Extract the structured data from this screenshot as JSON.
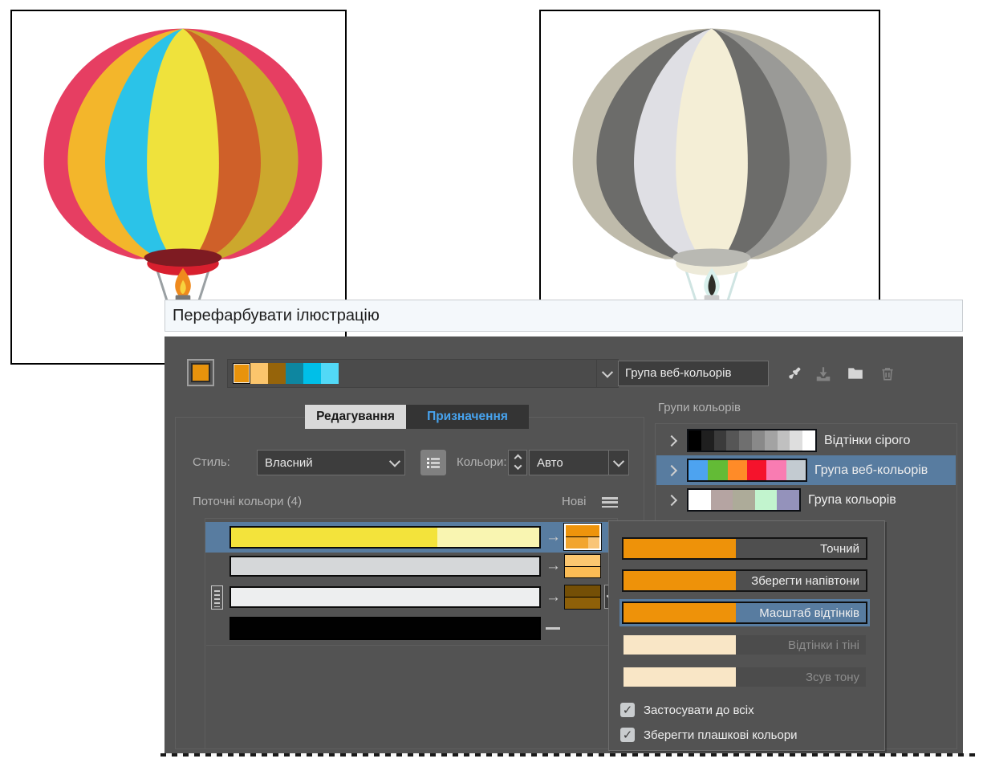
{
  "dialog": {
    "title": "Перефарбувати ілюстрацію",
    "toolbar": {
      "selected_swatch": "#E8930C",
      "swatches": [
        "#E8930C",
        "#FBC56C",
        "#96640A",
        "#0E86A0",
        "#00BFE8",
        "#52D9F7"
      ],
      "group_name_value": "Група веб-кольорів",
      "icons": [
        "eyedropper-icon",
        "save-swatches-icon",
        "folder-icon",
        "trash-icon"
      ]
    },
    "tabs": {
      "edit": "Редагування",
      "assign": "Призначення"
    },
    "style_row": {
      "style_label": "Стиль:",
      "style_value": "Власний",
      "colors_label": "Кольори:",
      "colors_value": "Авто"
    },
    "assign": {
      "current_label": "Поточні кольори (4)",
      "new_label": "Нові",
      "arrow_glyph": "→",
      "rows": [
        {
          "bar_left": "#F3E33B",
          "bar_right": "#F9F5B1",
          "new_top": "#EE940C",
          "new_bottom": "#F2A52E",
          "new_bottom_right": "#F9C577",
          "selected": "true"
        },
        {
          "bar": "#D5D7D9",
          "new_top": "#FCC770",
          "new_bottom": "#FBBC55"
        },
        {
          "bar": "#EDEEEF",
          "new_top": "#744F06",
          "new_bottom": "#8E6009"
        },
        {
          "bar": "#010101",
          "new": "none"
        }
      ]
    },
    "groups": {
      "label": "Групи кольорів",
      "items": [
        {
          "name": "Відтінки сірого",
          "colors": [
            "#000000",
            "#1F1F1F",
            "#3B3B3B",
            "#565656",
            "#6F6F6F",
            "#898989",
            "#A3A3A3",
            "#C0C0C0",
            "#DEDEDE",
            "#FFFFFF"
          ],
          "selected": false
        },
        {
          "name": "Група веб-кольорів",
          "colors": [
            "#4DA3F0",
            "#63BB36",
            "#FF8B28",
            "#F5132C",
            "#F97CB2",
            "#C3CBD1"
          ],
          "selected": true
        },
        {
          "name": "Група кольорів",
          "colors": [
            "#FFFFFF",
            "#B5A4A2",
            "#ADAB99",
            "#C2F4CE",
            "#9492BB"
          ],
          "selected": false
        }
      ]
    },
    "popup": {
      "options": [
        {
          "label": "Точний",
          "swatch": "#EE9209",
          "state": "normal"
        },
        {
          "label": "Зберегти напівтони",
          "swatch": "#EE9209",
          "state": "normal"
        },
        {
          "label": "Масштаб відтінків",
          "swatch": "#EE9209",
          "state": "selected"
        },
        {
          "label": "Відтінки і тіні",
          "swatch": "#F9E6C6",
          "state": "disabled"
        },
        {
          "label": "Зсув тону",
          "swatch": "#F9E6C6",
          "state": "disabled"
        }
      ],
      "checkboxes": [
        {
          "label": "Застосувати до всіх",
          "checked": true,
          "glyph": "✓"
        },
        {
          "label": "Зберегти плашкові кольори",
          "checked": true,
          "glyph": "✓"
        }
      ]
    },
    "accent_blue": "#587CA0",
    "dash_glyph": "—"
  },
  "balloons": {
    "left": {
      "envelope": "#E63E62",
      "left_outer": "#F3B62B",
      "left_inner": "#2BC3E8",
      "center": "#EFE23C",
      "right_outer": "#CCA82D",
      "right_inner": "#CF6029",
      "bowl_top": "#7E1B22",
      "bowl_front": "#D81F2E",
      "rope": "#9AA0A3",
      "basket": "#8F8F8F",
      "flame_outer": "#EF8A1D",
      "flame_inner": "#F7D23E"
    },
    "right": {
      "envelope": "#BFBBAB",
      "left_outer": "#6C6C6A",
      "left_inner": "#DFDFE4",
      "center": "#F4EED6",
      "right_outer": "#9A9A97",
      "right_inner": "#6C6C6A",
      "bowl_top": "#B9B9B3",
      "bowl_front": "#EDEAD9",
      "rope": "#CFE4E2",
      "basket": "#E8E8DF",
      "flame_outer": "#D8F0EC",
      "flame_inner": "#2E2E28"
    }
  }
}
